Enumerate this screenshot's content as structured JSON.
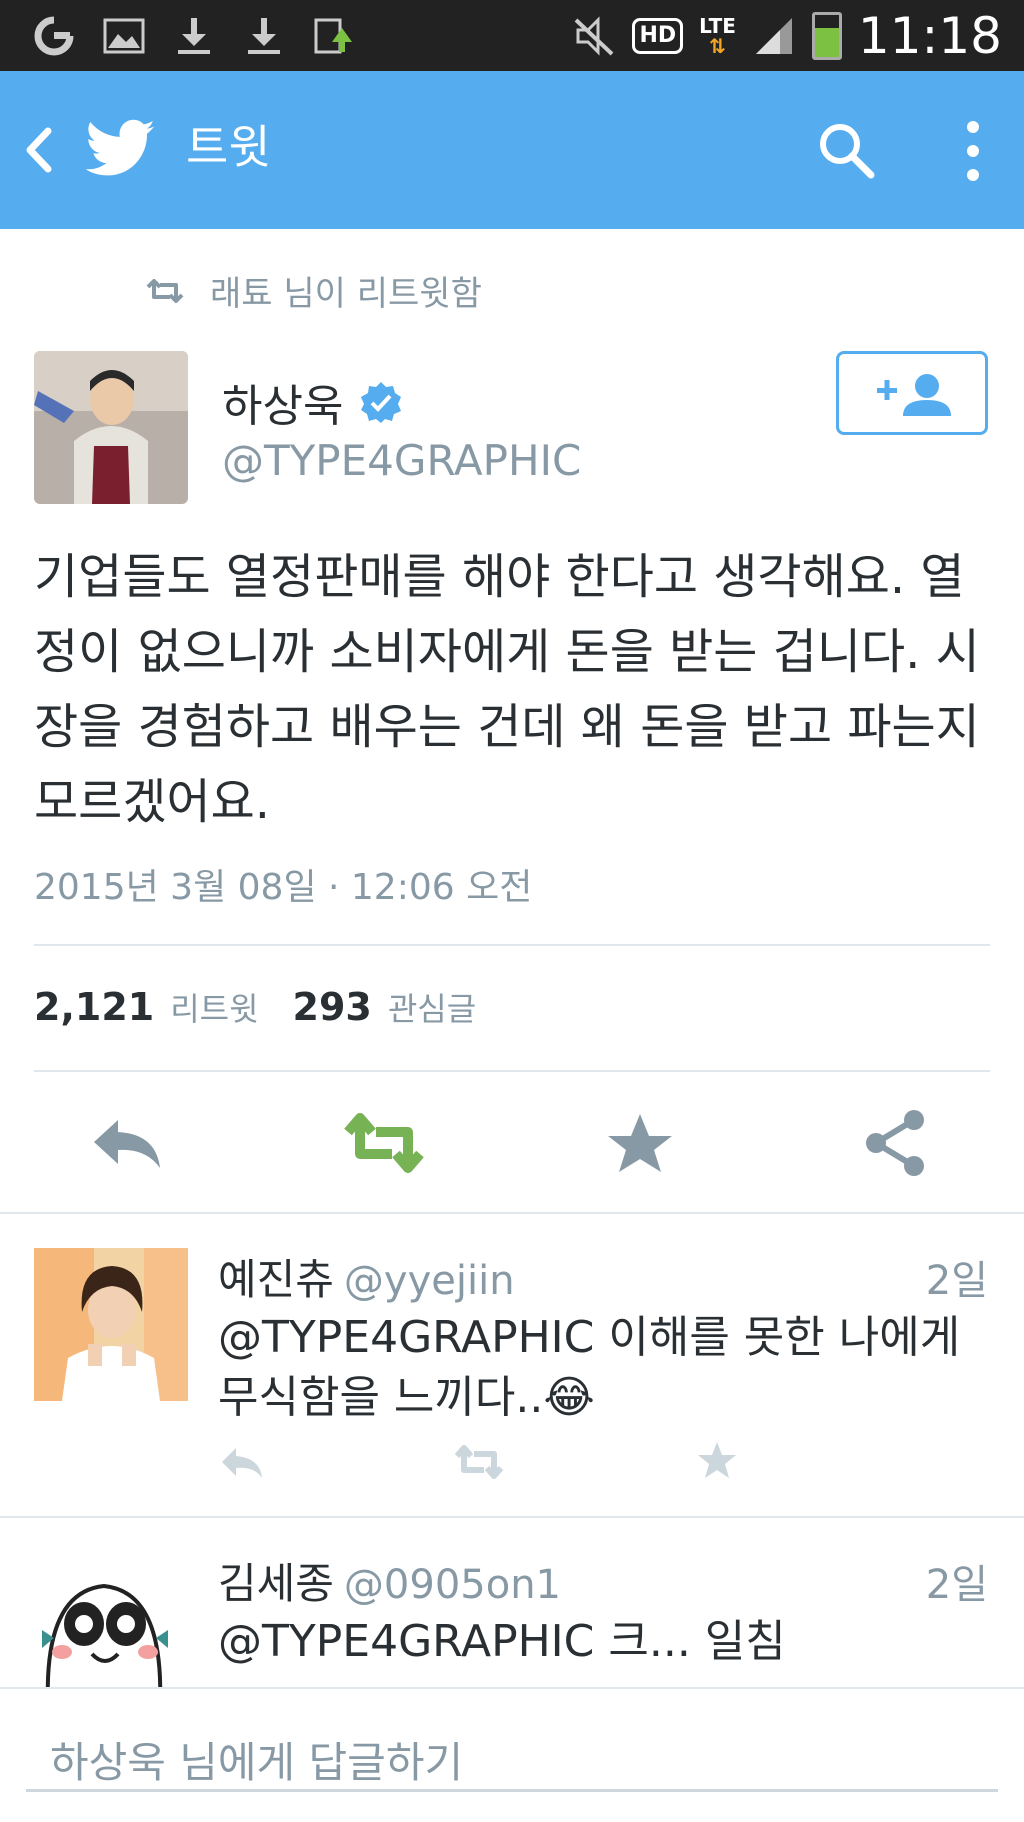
{
  "status_bar": {
    "time": "11:18",
    "hd_label": "HD",
    "lte_label": "LTE",
    "icons": [
      "sync-icon",
      "image-icon",
      "download-icon",
      "download-icon",
      "upload-icon",
      "mute-icon",
      "hd-icon",
      "lte-icon",
      "signal-icon",
      "battery-icon"
    ],
    "battery_level": 0.7
  },
  "app_bar": {
    "title": "트윗",
    "icons": [
      "back-icon",
      "twitter-bird-icon",
      "search-icon",
      "more-icon"
    ],
    "color": "#55acee"
  },
  "tweet": {
    "retweet_context": "래툐 님이 리트윗함",
    "author_name": "하상욱",
    "author_handle": "@TYPE4GRAPHIC",
    "verified": true,
    "text": "기업들도 열정판매를 해야 한다고 생각해요. 열정이 없으니까 소비자에게 돈을 받는 겁니다. 시장을 경험하고 배우는 건데 왜 돈을 받고 파는지 모르겠어요.",
    "timestamp": "2015년 3월 08일 · 12:06 오전",
    "retweet_count": "2,121",
    "retweet_label": "리트윗",
    "favorite_count": "293",
    "favorite_label": "관심글"
  },
  "replies": [
    {
      "name": "예진츄",
      "handle": "@yyejiin",
      "time": "2일",
      "text": "@TYPE4GRAPHIC 이해를 못한 나에게 무식함을 느끼다..😂"
    },
    {
      "name": "김세종",
      "handle": "@0905on1",
      "time": "2일",
      "text": "@TYPE4GRAPHIC 크... 일침"
    }
  ],
  "compose": {
    "placeholder": "하상욱 님에게 답글하기"
  },
  "colors": {
    "accent": "#55acee",
    "retweet_green": "#77b255",
    "muted": "#8899a6",
    "action_gray": "#8899a6"
  }
}
